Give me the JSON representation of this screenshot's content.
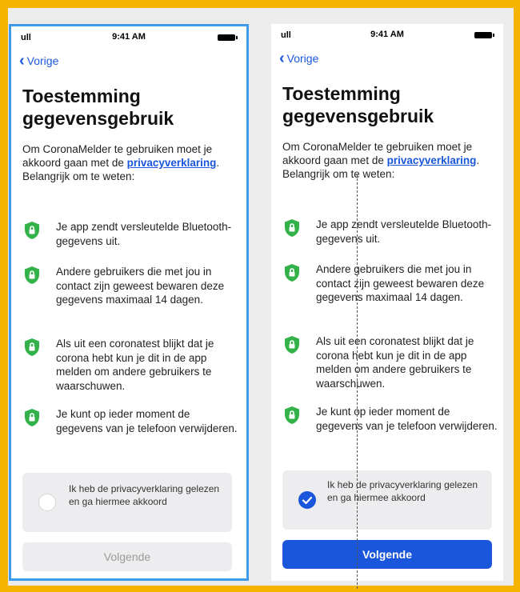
{
  "colors": {
    "frame": "#f5b400",
    "accent": "#1a56db",
    "shield": "#34b24a",
    "selection_border": "#3d9be9"
  },
  "status": {
    "time": "9:41 AM",
    "signal": "ull"
  },
  "nav": {
    "back_label": "Vorige"
  },
  "screen": {
    "title_line1": "Toestemming",
    "title_line2": "gegevensgebruik",
    "intro_before": "Om CoronaMelder te gebruiken moet je akkoord gaan met de ",
    "intro_link": "privacyverklaring",
    "intro_after": ". Belangrijk om te weten:",
    "points": [
      "Je app zendt versleutelde Bluetooth-gegevens uit.",
      "Andere gebruikers die met jou in contact zijn geweest bewaren deze gegevens maximaal 14 dagen.",
      "Als uit een coronatest blijkt dat je corona hebt kun je dit in de app melden om andere gebruikers te waarschuwen.",
      "Je kunt op ieder moment de gegevens van je telefoon verwijderen."
    ],
    "consent_text": "Ik heb de privacyverklaring gelezen en ga hiermee akkoord",
    "next_label": "Volgende"
  },
  "icons": {
    "back": "chevron-left-icon",
    "point": "shield-lock-icon",
    "checked": "checkmark-icon"
  },
  "state": {
    "left_consent_checked": false,
    "right_consent_checked": true
  }
}
